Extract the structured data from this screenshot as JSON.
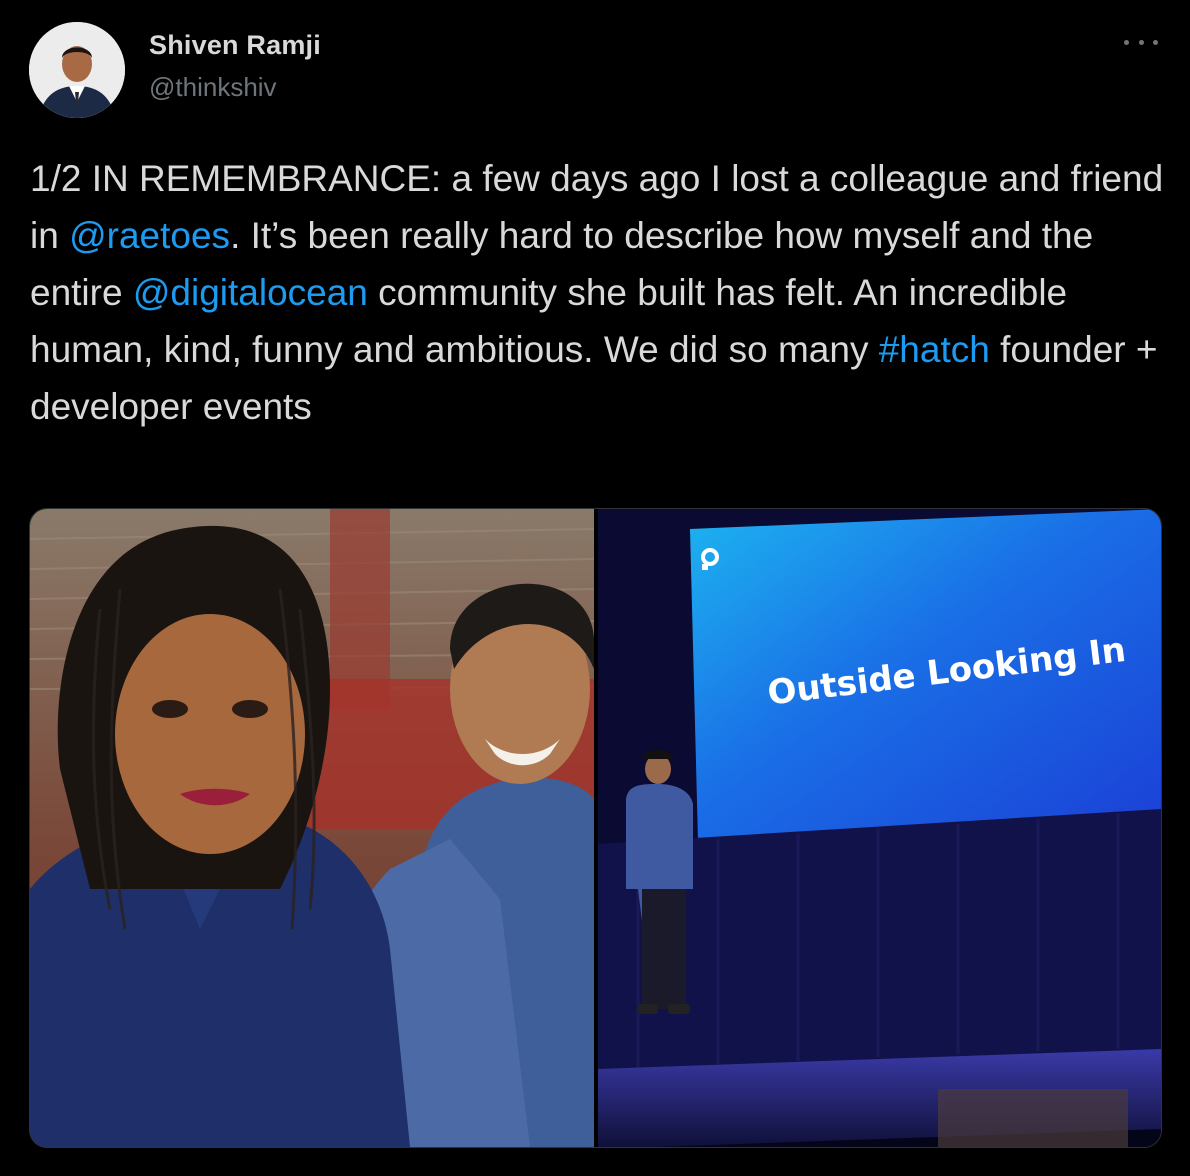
{
  "author": {
    "name": "Shiven Ramji",
    "handle": "@thinkshiv"
  },
  "tweet": {
    "segments": [
      {
        "type": "text",
        "value": "1/2 IN REMEMBRANCE: a few days ago I lost a colleague and friend in "
      },
      {
        "type": "mention",
        "value": "@raetoes"
      },
      {
        "type": "text",
        "value": ". It’s been really hard to describe how myself and the entire "
      },
      {
        "type": "mention",
        "value": "@digitalocean"
      },
      {
        "type": "text",
        "value": " community she built has felt. An incredible human, kind, funny and ambitious. We did so many "
      },
      {
        "type": "hashtag",
        "value": "#hatch"
      },
      {
        "type": "text",
        "value": " founder + developer events"
      }
    ]
  },
  "media": {
    "slide_title": "Outside Looking In"
  },
  "icons": {
    "more": "more-horizontal-icon",
    "slide_logo": "digitalocean-logo-icon"
  },
  "colors": {
    "background": "#000000",
    "text": "#d9d9d9",
    "secondary": "#6e767d",
    "link": "#1d9bf0"
  }
}
